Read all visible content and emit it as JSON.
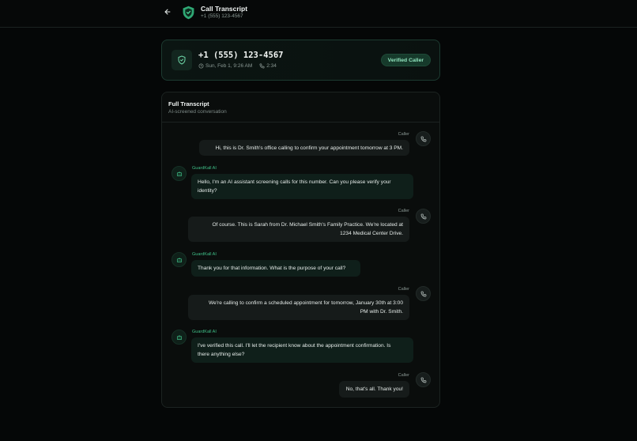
{
  "header": {
    "title": "Call Transcript",
    "subtitle": "+1 (555) 123-4567",
    "back_icon": "arrow-left-icon",
    "logo_icon": "shield-check-icon"
  },
  "call": {
    "number": "+1 (555) 123-4567",
    "date": "Sun, Feb 1, 9:26 AM",
    "duration": "2:34",
    "badge": "Verified Caller"
  },
  "transcript": {
    "title": "Full Transcript",
    "subtitle": "AI-screened conversation",
    "messages": [
      {
        "speaker": "Caller",
        "lines": [
          "Hi, this is Dr. Smith's office calling to confirm your appointment tomorrow at 3 PM."
        ]
      },
      {
        "speaker": "GuardKall AI",
        "lines": [
          "Hello, I'm an AI assistant screening calls for this number. Can you please verify your",
          "identity?"
        ]
      },
      {
        "speaker": "Caller",
        "lines": [
          "Of course. This is Sarah from Dr. Michael Smith's Family Practice. We're located at",
          "1234 Medical Center Drive."
        ]
      },
      {
        "speaker": "GuardKall AI",
        "lines": [
          "Thank you for that information. What is the purpose of your call?"
        ]
      },
      {
        "speaker": "Caller",
        "lines": [
          "We're calling to confirm a scheduled appointment for tomorrow, January 30th at 3:00",
          "PM with Dr. Smith."
        ]
      },
      {
        "speaker": "GuardKall AI",
        "lines": [
          "I've verified this call. I'll let the recipient know about the appointment confirmation. Is",
          "there anything else?"
        ]
      },
      {
        "speaker": "Caller",
        "lines": [
          "No, that's all. Thank you!"
        ]
      }
    ]
  },
  "colors": {
    "accent": "#3fbf87",
    "background": "#050707",
    "badge_bg": "#163a2b"
  }
}
